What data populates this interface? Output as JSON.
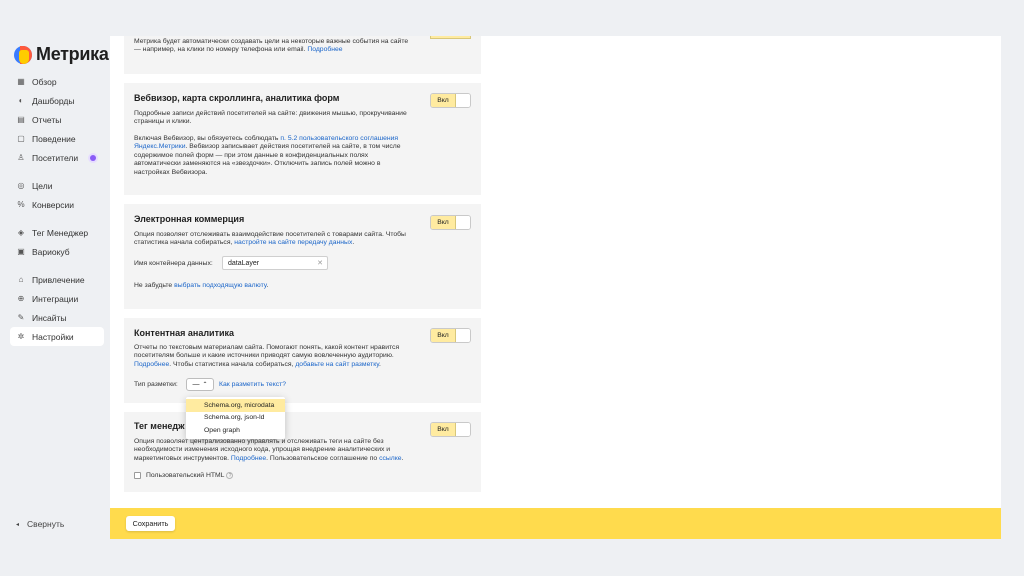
{
  "app": {
    "logo_text": "Метрика"
  },
  "sidebar": {
    "items": [
      {
        "label": "Обзор",
        "icon": "grid-icon"
      },
      {
        "label": "Дашборды",
        "icon": "dashboard-icon"
      },
      {
        "label": "Отчеты",
        "icon": "report-icon"
      },
      {
        "label": "Поведение",
        "icon": "behavior-icon"
      },
      {
        "label": "Посетители",
        "icon": "user-icon"
      },
      {
        "label": "Цели",
        "icon": "target-icon"
      },
      {
        "label": "Конверсии",
        "icon": "percent-icon"
      },
      {
        "label": "Тег Менеджер",
        "icon": "tag-icon"
      },
      {
        "label": "Вариокуб",
        "icon": "cube-icon"
      },
      {
        "label": "Привлечение",
        "icon": "acquisition-icon"
      },
      {
        "label": "Интеграции",
        "icon": "integration-icon"
      },
      {
        "label": "Инсайты",
        "icon": "insight-icon"
      },
      {
        "label": "Настройки",
        "icon": "gear-icon"
      }
    ],
    "collapse_label": "Свернуть"
  },
  "cards": {
    "goals": {
      "text": "Метрика будет автоматически создавать цели на некоторые важные события на сайте — например, на клики по номеру телефона или email.",
      "link": "Подробнее"
    },
    "webvisor": {
      "title": "Вебвизор, карта скроллинга, аналитика форм",
      "desc": "Подробные записи действий посетителей на сайте: движения мышью, прокручивание страницы и клики.",
      "agree_pre": "Включая Вебвизор, вы обязуетесь соблюдать",
      "agree_link": "п. 5.2 пользовательского соглашения Яндекс.Метрики",
      "agree_post": ". Вебвизор записывает действия посетителей на сайте, в том числе содержимое полей форм — при этом данные в конфиденциальных полях автоматически заменяются на «звездочки». Отключить запись полей можно в настройках Вебвизора.",
      "toggle": "Вкл"
    },
    "ecommerce": {
      "title": "Электронная коммерция",
      "desc": "Опция позволяет отслеживать взаимодействие посетителей с товарами сайта. Чтобы статистика начала собираться,",
      "desc_link": "настройте на сайте передачу данных",
      "container_label": "Имя контейнера данных:",
      "container_value": "dataLayer",
      "currency_pre": "Не забудьте",
      "currency_link": "выбрать подходящую валюту",
      "toggle": "Вкл"
    },
    "content": {
      "title": "Контентная аналитика",
      "desc": "Отчеты по текстовым материалам сайта. Помогают понять, какой контент нравится посетителям больше и какие источники приводят самую вовлеченную аудиторию.",
      "desc_link1": "Подробнее",
      "desc_mid": ". Чтобы статистика начала собираться,",
      "desc_link2": "добавьте на сайт разметку",
      "markup_label": "Тип разметки:",
      "markup_value": "—",
      "markup_help": "Как разметить текст?",
      "toggle": "Вкл",
      "dropdown": [
        "Schema.org, microdata",
        "Schema.org, json-ld",
        "Open graph"
      ]
    },
    "tagmanager": {
      "title": "Тег менедж",
      "desc": "Опция позволяет централизованно управлять и отслеживать теги на сайте без необходимости изменения исходного кода, упрощая внедрение аналитических и маркетинговых инструментов.",
      "desc_link": "Подробнее",
      "desc_mid": ". Пользовательское соглашение по",
      "desc_link2": "ссылке",
      "custom_html": "Пользовательский HTML",
      "toggle": "Вкл"
    }
  },
  "footer": {
    "save_label": "Сохранить"
  },
  "colors": {
    "accent": "#ffdb4d",
    "link": "#1a65c9",
    "toggle_on": "#ffeba0"
  }
}
